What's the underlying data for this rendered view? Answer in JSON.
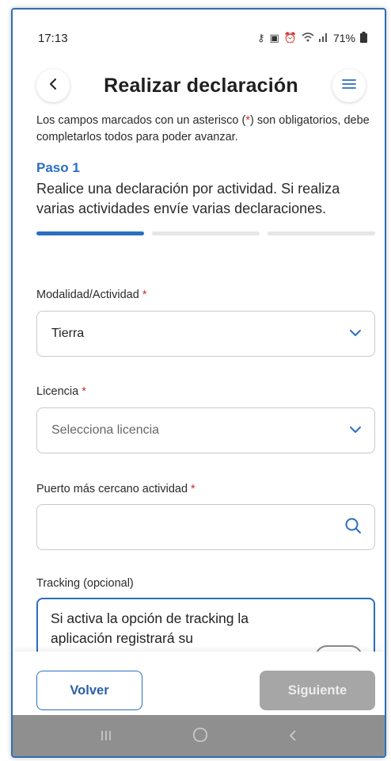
{
  "status_bar": {
    "time": "17:13",
    "battery": "71%",
    "icons": [
      "key-icon",
      "lock-icon",
      "alarm-icon",
      "wifi-icon",
      "signal-icon",
      "battery-icon"
    ]
  },
  "header": {
    "title": "Realizar declaración",
    "back_icon": "chevron-left-icon",
    "menu_icon": "hamburger-menu-icon"
  },
  "intro": {
    "before": "Los campos marcados con un asterisco (",
    "asterisk": "*",
    "after": ") son obligatorios, debe completarlos todos para poder avanzar."
  },
  "step": {
    "title": "Paso 1",
    "text": "Realice una declaración por actividad. Si realiza varias actividades envíe varias declaraciones.",
    "current": 1,
    "total": 3
  },
  "fields": {
    "modalidad": {
      "label": "Modalidad/Actividad",
      "required_mark": "*",
      "value": "Tierra"
    },
    "licencia": {
      "label": "Licencia",
      "required_mark": "*",
      "placeholder": "Selecciona licencia"
    },
    "puerto": {
      "label": "Puerto más cercano actividad",
      "required_mark": "*",
      "value": ""
    },
    "tracking": {
      "label": "Tracking (opcional)",
      "text": "Si activa la opción de tracking la aplicación registrará su"
    }
  },
  "buttons": {
    "back": "Volver",
    "next": "Siguiente"
  },
  "colors": {
    "accent": "#2a6fc1",
    "required": "#d12b2b",
    "disabled_button": "#a6a6a6",
    "nav_bar": "#8f8f8f"
  }
}
